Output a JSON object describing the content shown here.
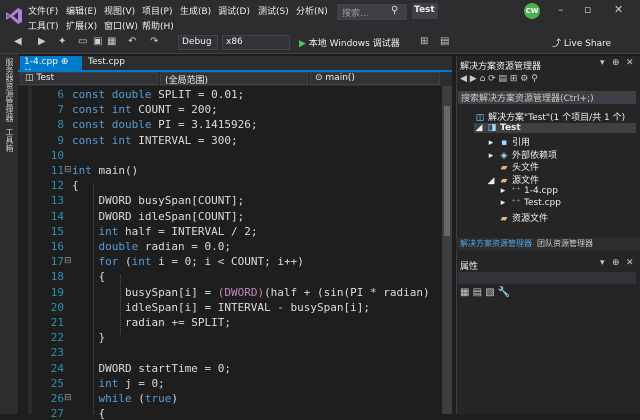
{
  "menu": {
    "items": [
      "文件(F)",
      "编辑(E)",
      "视图(V)",
      "项目(P)",
      "生成(B)",
      "调试(D)",
      "测试(S)",
      "分析(N)",
      "工具(T)",
      "扩展(X)",
      "窗口(W)",
      "帮助(H)"
    ],
    "search_placeholder": "搜索...",
    "solution_name": "Test",
    "user_initials": "CW"
  },
  "toolbar": {
    "config": "Debug",
    "platform": "x86",
    "run_label": "本地 Windows 调试器",
    "liveshare": "Live Share"
  },
  "left_tools": {
    "server_explorer": "服务器资源管理器",
    "toolbox": "工具箱"
  },
  "tabs": [
    {
      "label": "1-4.cpp",
      "pin": "⊕",
      "close": "×"
    },
    {
      "label": "Test.cpp"
    }
  ],
  "nav": {
    "project": "Test",
    "scope": "(全局范围)",
    "member": "main()"
  },
  "code_lines": [
    {
      "n": "6",
      "tokens": [
        [
          "kw",
          "const "
        ],
        [
          "kw",
          "double "
        ],
        [
          "",
          "SPLIT = 0.01;"
        ]
      ]
    },
    {
      "n": "7",
      "tokens": [
        [
          "kw",
          "const "
        ],
        [
          "kw",
          "int "
        ],
        [
          "",
          "COUNT = 200;"
        ]
      ]
    },
    {
      "n": "8",
      "tokens": [
        [
          "kw",
          "const "
        ],
        [
          "kw",
          "double "
        ],
        [
          "",
          "PI = 3.1415926;"
        ]
      ]
    },
    {
      "n": "9",
      "tokens": [
        [
          "kw",
          "const "
        ],
        [
          "kw",
          "int "
        ],
        [
          "",
          "INTERVAL = 300;"
        ]
      ]
    },
    {
      "n": "10",
      "tokens": []
    },
    {
      "n": "11",
      "tokens": [
        [
          "kw",
          "int "
        ],
        [
          "",
          "main()"
        ]
      ],
      "fold": "⊟"
    },
    {
      "n": "12",
      "tokens": [
        [
          "",
          "{"
        ]
      ]
    },
    {
      "n": "13",
      "tokens": [
        [
          "",
          "    DWORD busySpan[COUNT];"
        ]
      ]
    },
    {
      "n": "14",
      "tokens": [
        [
          "",
          "    DWORD idleSpan[COUNT];"
        ]
      ]
    },
    {
      "n": "15",
      "tokens": [
        [
          "",
          "    "
        ],
        [
          "kw",
          "int "
        ],
        [
          "",
          "half = INTERVAL / 2;"
        ]
      ]
    },
    {
      "n": "16",
      "tokens": [
        [
          "",
          "    "
        ],
        [
          "kw",
          "double "
        ],
        [
          "",
          "radian = 0.0;"
        ]
      ]
    },
    {
      "n": "17",
      "tokens": [
        [
          "",
          "    "
        ],
        [
          "kw",
          "for "
        ],
        [
          "",
          "("
        ],
        [
          "kw",
          "int "
        ],
        [
          "",
          "i = 0; i < COUNT; i++)"
        ]
      ],
      "fold": "⊟"
    },
    {
      "n": "18",
      "tokens": [
        [
          "",
          "    {"
        ]
      ]
    },
    {
      "n": "19",
      "tokens": [
        [
          "",
          "        busySpan[i] = "
        ],
        [
          "mac",
          "(DWORD)"
        ],
        [
          "",
          "(half + (sin(PI * radian)"
        ]
      ]
    },
    {
      "n": "20",
      "tokens": [
        [
          "",
          "        idleSpan[i] = INTERVAL - busySpan[i];"
        ]
      ]
    },
    {
      "n": "21",
      "tokens": [
        [
          "",
          "        radian += SPLIT;"
        ]
      ]
    },
    {
      "n": "22",
      "tokens": [
        [
          "",
          "    }"
        ]
      ]
    },
    {
      "n": "23",
      "tokens": []
    },
    {
      "n": "24",
      "tokens": [
        [
          "",
          "    DWORD startTime = 0;"
        ]
      ]
    },
    {
      "n": "25",
      "tokens": [
        [
          "",
          "    "
        ],
        [
          "kw",
          "int "
        ],
        [
          "",
          "j = 0;"
        ]
      ]
    },
    {
      "n": "26",
      "tokens": [
        [
          "",
          "    "
        ],
        [
          "kw",
          "while "
        ],
        [
          "",
          "("
        ],
        [
          "kw",
          "true"
        ],
        [
          "",
          ")"
        ]
      ],
      "fold": "⊟"
    },
    {
      "n": "27",
      "tokens": [
        [
          "",
          "    {"
        ]
      ]
    }
  ],
  "solution_explorer": {
    "title": "解决方案资源管理器",
    "search_placeholder": "搜索解决方案资源管理器(Ctrl+;)",
    "items": [
      {
        "label": "解决方案\"Test\"(1 个项目/共 1 个)",
        "indent": 0
      },
      {
        "label": "Test",
        "indent": 1,
        "bold": true,
        "selected": true
      },
      {
        "label": "引用",
        "indent": 2
      },
      {
        "label": "外部依赖项",
        "indent": 2
      },
      {
        "label": "头文件",
        "indent": 2
      },
      {
        "label": "源文件",
        "indent": 2
      },
      {
        "label": "1-4.cpp",
        "indent": 3
      },
      {
        "label": "Test.cpp",
        "indent": 3
      },
      {
        "label": "资源文件",
        "indent": 2
      }
    ],
    "bottom_tabs": [
      "解决方案资源管理器",
      "团队资源管理器"
    ]
  },
  "properties": {
    "title": "属性"
  }
}
